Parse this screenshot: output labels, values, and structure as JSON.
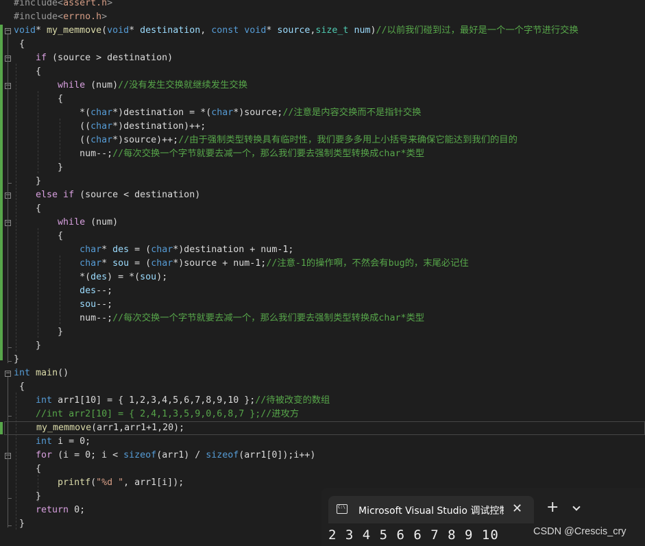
{
  "editor": {
    "lines": [
      {
        "n": 0,
        "tokens": [
          {
            "t": "#include<",
            "c": "pp"
          },
          {
            "t": "assert.h",
            "c": "hdr"
          },
          {
            "t": ">",
            "c": "pp"
          }
        ]
      },
      {
        "n": 1,
        "tokens": [
          {
            "t": "#include<",
            "c": "pp"
          },
          {
            "t": "errno.h",
            "c": "hdr"
          },
          {
            "t": ">",
            "c": "pp"
          }
        ]
      },
      {
        "n": 2,
        "tokens": [
          {
            "t": "void",
            "c": "kw"
          },
          {
            "t": "* ",
            "c": ""
          },
          {
            "t": "my_memmove",
            "c": "fn"
          },
          {
            "t": "(",
            "c": ""
          },
          {
            "t": "void",
            "c": "kw"
          },
          {
            "t": "* ",
            "c": ""
          },
          {
            "t": "destination",
            "c": "pm"
          },
          {
            "t": ", ",
            "c": ""
          },
          {
            "t": "const",
            "c": "kw"
          },
          {
            "t": " ",
            "c": ""
          },
          {
            "t": "void",
            "c": "kw"
          },
          {
            "t": "* ",
            "c": ""
          },
          {
            "t": "source",
            "c": "pm"
          },
          {
            "t": ",",
            "c": ""
          },
          {
            "t": "size_t",
            "c": "tp"
          },
          {
            "t": " ",
            "c": ""
          },
          {
            "t": "num",
            "c": "pm"
          },
          {
            "t": ")",
            "c": ""
          },
          {
            "t": "//以前我们碰到过，最好是一个一个字节进行交换",
            "c": "cm"
          }
        ]
      },
      {
        "n": 3,
        "tokens": [
          {
            "t": " {",
            "c": ""
          }
        ]
      },
      {
        "n": 4,
        "tokens": [
          {
            "t": "    ",
            "c": ""
          },
          {
            "t": "if",
            "c": "ctl"
          },
          {
            "t": " (source > destination)",
            "c": ""
          }
        ]
      },
      {
        "n": 5,
        "tokens": [
          {
            "t": "    {",
            "c": ""
          }
        ]
      },
      {
        "n": 6,
        "tokens": [
          {
            "t": "        ",
            "c": ""
          },
          {
            "t": "while",
            "c": "ctl"
          },
          {
            "t": " (num)",
            "c": ""
          },
          {
            "t": "//没有发生交换就继续发生交换",
            "c": "cm"
          }
        ]
      },
      {
        "n": 7,
        "tokens": [
          {
            "t": "        {",
            "c": ""
          }
        ]
      },
      {
        "n": 8,
        "tokens": [
          {
            "t": "            *(",
            "c": ""
          },
          {
            "t": "char",
            "c": "kw"
          },
          {
            "t": "*)destination = *(",
            "c": ""
          },
          {
            "t": "char",
            "c": "kw"
          },
          {
            "t": "*)source;",
            "c": ""
          },
          {
            "t": "//注意是内容交换而不是指针交换",
            "c": "cm"
          }
        ]
      },
      {
        "n": 9,
        "tokens": [
          {
            "t": "            ((",
            "c": ""
          },
          {
            "t": "char",
            "c": "kw"
          },
          {
            "t": "*)destination)++;",
            "c": ""
          }
        ]
      },
      {
        "n": 10,
        "tokens": [
          {
            "t": "            ((",
            "c": ""
          },
          {
            "t": "char",
            "c": "kw"
          },
          {
            "t": "*)source)++;",
            "c": ""
          },
          {
            "t": "//由于强制类型转换具有临时性，我们要多多用上小括号来确保它能达到我们的目的",
            "c": "cm"
          }
        ]
      },
      {
        "n": 11,
        "tokens": [
          {
            "t": "            num--;",
            "c": ""
          },
          {
            "t": "//每次交换一个字节就要去减一个，那么我们要去强制类型转换成char*类型",
            "c": "cm"
          }
        ]
      },
      {
        "n": 12,
        "tokens": [
          {
            "t": "        }",
            "c": ""
          }
        ]
      },
      {
        "n": 13,
        "tokens": [
          {
            "t": "    }",
            "c": ""
          }
        ]
      },
      {
        "n": 14,
        "tokens": [
          {
            "t": "    ",
            "c": ""
          },
          {
            "t": "else if",
            "c": "ctl"
          },
          {
            "t": " (source < destination)",
            "c": ""
          }
        ]
      },
      {
        "n": 15,
        "tokens": [
          {
            "t": "    {",
            "c": ""
          }
        ]
      },
      {
        "n": 16,
        "tokens": [
          {
            "t": "        ",
            "c": ""
          },
          {
            "t": "while",
            "c": "ctl"
          },
          {
            "t": " (num)",
            "c": ""
          }
        ]
      },
      {
        "n": 17,
        "tokens": [
          {
            "t": "        {",
            "c": ""
          }
        ]
      },
      {
        "n": 18,
        "tokens": [
          {
            "t": "            ",
            "c": ""
          },
          {
            "t": "char",
            "c": "kw"
          },
          {
            "t": "* ",
            "c": ""
          },
          {
            "t": "des",
            "c": "pm"
          },
          {
            "t": " = (",
            "c": ""
          },
          {
            "t": "char",
            "c": "kw"
          },
          {
            "t": "*)destination + num-1;",
            "c": ""
          }
        ]
      },
      {
        "n": 19,
        "tokens": [
          {
            "t": "            ",
            "c": ""
          },
          {
            "t": "char",
            "c": "kw"
          },
          {
            "t": "* ",
            "c": ""
          },
          {
            "t": "sou",
            "c": "pm"
          },
          {
            "t": " = (",
            "c": ""
          },
          {
            "t": "char",
            "c": "kw"
          },
          {
            "t": "*)source + num-1;",
            "c": ""
          },
          {
            "t": "//注意-1的操作啊，不然会有bug的，末尾必记住",
            "c": "cm"
          }
        ]
      },
      {
        "n": 20,
        "tokens": [
          {
            "t": "            *(",
            "c": ""
          },
          {
            "t": "des",
            "c": "pm"
          },
          {
            "t": ") = *(",
            "c": ""
          },
          {
            "t": "sou",
            "c": "pm"
          },
          {
            "t": ");",
            "c": ""
          }
        ]
      },
      {
        "n": 21,
        "tokens": [
          {
            "t": "            ",
            "c": ""
          },
          {
            "t": "des",
            "c": "pm"
          },
          {
            "t": "--;",
            "c": ""
          }
        ]
      },
      {
        "n": 22,
        "tokens": [
          {
            "t": "            ",
            "c": ""
          },
          {
            "t": "sou",
            "c": "pm"
          },
          {
            "t": "--;",
            "c": ""
          }
        ]
      },
      {
        "n": 23,
        "tokens": [
          {
            "t": "            num--;",
            "c": ""
          },
          {
            "t": "//每次交换一个字节就要去减一个，那么我们要去强制类型转换成char*类型",
            "c": "cm"
          }
        ]
      },
      {
        "n": 24,
        "tokens": [
          {
            "t": "        }",
            "c": ""
          }
        ]
      },
      {
        "n": 25,
        "tokens": [
          {
            "t": "    }",
            "c": ""
          }
        ]
      },
      {
        "n": 26,
        "tokens": [
          {
            "t": "}",
            "c": ""
          }
        ]
      },
      {
        "n": 27,
        "tokens": [
          {
            "t": "int",
            "c": "kw"
          },
          {
            "t": " ",
            "c": ""
          },
          {
            "t": "main",
            "c": "fn"
          },
          {
            "t": "()",
            "c": ""
          }
        ]
      },
      {
        "n": 28,
        "tokens": [
          {
            "t": " {",
            "c": ""
          }
        ]
      },
      {
        "n": 29,
        "tokens": [
          {
            "t": "    ",
            "c": ""
          },
          {
            "t": "int",
            "c": "kw"
          },
          {
            "t": " arr1[10] = { 1,2,3,4,5,6,7,8,9,10 };",
            "c": ""
          },
          {
            "t": "//待被改变的数组",
            "c": "cm"
          }
        ]
      },
      {
        "n": 30,
        "tokens": [
          {
            "t": "    ",
            "c": ""
          },
          {
            "t": "//int arr2[10] = { 2,4,1,3,5,9,0,6,8,7 };//进攻方",
            "c": "cm"
          }
        ]
      },
      {
        "n": 31,
        "tokens": [
          {
            "t": "    ",
            "c": ""
          },
          {
            "t": "my_memmove",
            "c": "fn"
          },
          {
            "t": "(arr1,arr1+1,20);",
            "c": ""
          }
        ]
      },
      {
        "n": 32,
        "tokens": [
          {
            "t": "    ",
            "c": ""
          },
          {
            "t": "int",
            "c": "kw"
          },
          {
            "t": " i = 0;",
            "c": ""
          }
        ]
      },
      {
        "n": 33,
        "tokens": [
          {
            "t": "    ",
            "c": ""
          },
          {
            "t": "for",
            "c": "ctl"
          },
          {
            "t": " (i = 0; i < ",
            "c": ""
          },
          {
            "t": "sizeof",
            "c": "kw"
          },
          {
            "t": "(arr1) / ",
            "c": ""
          },
          {
            "t": "sizeof",
            "c": "kw"
          },
          {
            "t": "(arr1[0]);i++)",
            "c": ""
          }
        ]
      },
      {
        "n": 34,
        "tokens": [
          {
            "t": "    {",
            "c": ""
          }
        ]
      },
      {
        "n": 35,
        "tokens": [
          {
            "t": "        ",
            "c": ""
          },
          {
            "t": "printf",
            "c": "fn"
          },
          {
            "t": "(",
            "c": ""
          },
          {
            "t": "\"%d \"",
            "c": "st"
          },
          {
            "t": ", arr1[i]);",
            "c": ""
          }
        ]
      },
      {
        "n": 36,
        "tokens": [
          {
            "t": "    }",
            "c": ""
          }
        ]
      },
      {
        "n": 37,
        "tokens": [
          {
            "t": "    ",
            "c": ""
          },
          {
            "t": "return",
            "c": "ctl"
          },
          {
            "t": " 0;",
            "c": ""
          }
        ]
      },
      {
        "n": 38,
        "tokens": [
          {
            "t": " }",
            "c": ""
          }
        ]
      }
    ],
    "fold_markers": [
      "−",
      "−",
      "−",
      "−",
      "−",
      "−",
      "−",
      "−"
    ],
    "highlighted_line": 31
  },
  "terminal": {
    "icon": "terminal-icon",
    "tab_title": "Microsoft Visual Studio 调试控制台",
    "close_glyph": "✕",
    "new_tab_glyph": "+",
    "output": "2 3 4 5 6 6 7 8 9 10"
  },
  "watermark": "CSDN @Crescis_cry"
}
